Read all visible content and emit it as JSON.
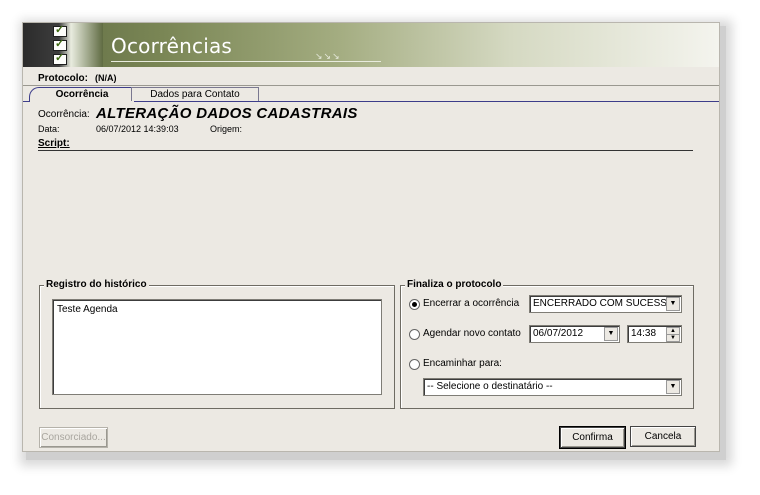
{
  "window": {
    "title": "Ocorrências",
    "title_arrows": "↘↘↘"
  },
  "protocol": {
    "label": "Protocolo:",
    "value": "(N/A)"
  },
  "tabs": [
    {
      "label": "Ocorrência",
      "active": true
    },
    {
      "label": "Dados para Contato",
      "active": false
    }
  ],
  "occurrence": {
    "label": "Ocorrência:",
    "value": "ALTERAÇÃO DADOS CADASTRAIS",
    "date_label": "Data:",
    "date_value": "06/07/2012 14:39:03",
    "origin_label": "Origem:",
    "script_label": "Script:"
  },
  "history": {
    "title": "Registro do histórico",
    "text": "Teste Agenda"
  },
  "finalize": {
    "title": "Finaliza o protocolo",
    "options": [
      {
        "label": "Encerrar a ocorrência",
        "selected": true
      },
      {
        "label": "Agendar novo contato",
        "selected": false
      },
      {
        "label": "Encaminhar para:",
        "selected": false
      }
    ],
    "status_value": "ENCERRADO COM SUCESSO",
    "schedule_date": "06/07/2012",
    "schedule_time": "14:38",
    "recipient_placeholder": "-- Selecione o destinatário --"
  },
  "buttons": {
    "consorciado": "Consorciado...",
    "confirma": "Confirma",
    "cancela": "Cancela"
  },
  "icons": {
    "logo": "checklist-icon",
    "dropdown": "chevron-down-icon",
    "spin": "spin-arrows-icon"
  },
  "colors": {
    "banner": "#7a8655",
    "tab_accent": "#3d3d8a",
    "window_bg": "#ece9e3"
  }
}
